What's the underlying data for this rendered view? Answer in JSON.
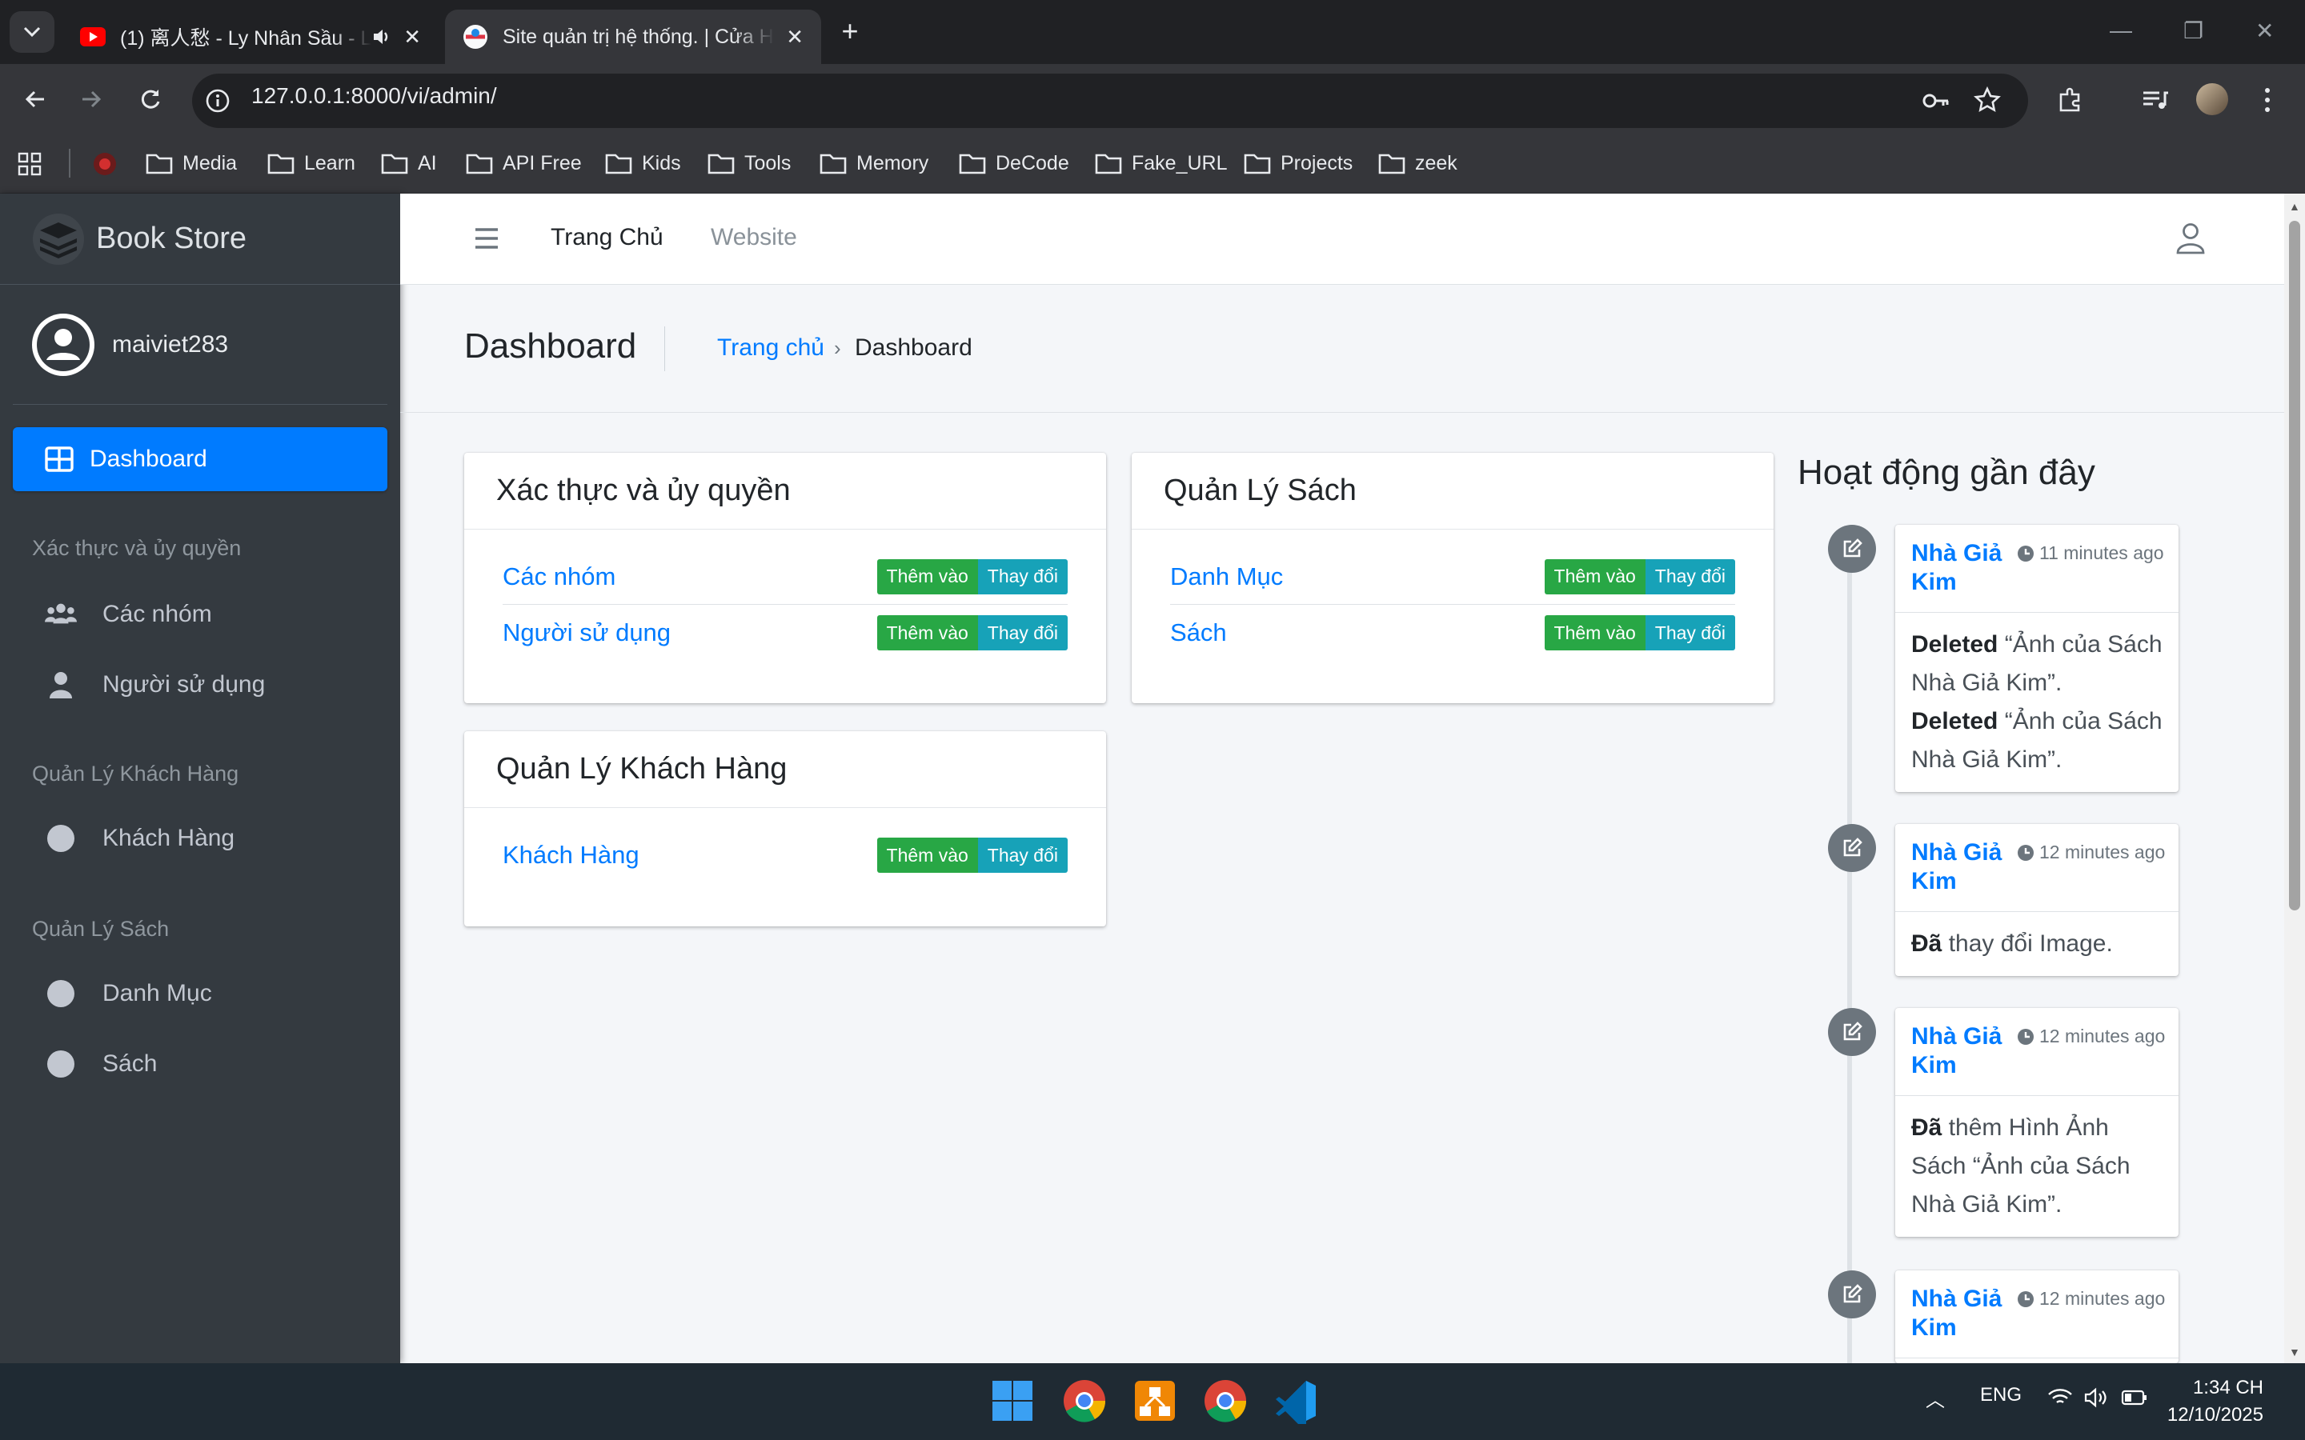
{
  "browser": {
    "tabs": [
      {
        "title": "(1) 离人愁 - Ly Nhân Sầu - L",
        "icon": "youtube-icon",
        "audio": true
      },
      {
        "title": "Site quản trị hệ thống. | Cửa Hà",
        "icon": "site-favicon",
        "active": true
      }
    ],
    "url": "127.0.0.1:8000/vi/admin/",
    "bookmarks": [
      "Media",
      "Learn",
      "AI",
      "API Free",
      "Kids",
      "Tools",
      "Memory",
      "DeCode",
      "Fake_URL",
      "Projects",
      "zeek"
    ]
  },
  "sidebar": {
    "brand": "Book Store",
    "user": "maiviet283",
    "active_item": "Dashboard",
    "sections": [
      {
        "header": "Xác thực và ủy quyền",
        "items": [
          {
            "label": "Các nhóm",
            "icon": "users-icon"
          },
          {
            "label": "Người sử dụng",
            "icon": "user-icon"
          }
        ]
      },
      {
        "header": "Quản Lý Khách Hàng",
        "items": [
          {
            "label": "Khách Hàng",
            "icon": "circle-icon"
          }
        ]
      },
      {
        "header": "Quản Lý Sách",
        "items": [
          {
            "label": "Danh Mục",
            "icon": "circle-icon"
          },
          {
            "label": "Sách",
            "icon": "circle-icon"
          }
        ]
      }
    ]
  },
  "topnav": {
    "home": "Trang Chủ",
    "website": "Website"
  },
  "header": {
    "title": "Dashboard",
    "breadcrumb": [
      "Trang chủ",
      "Dashboard"
    ],
    "sep": "›"
  },
  "buttons": {
    "add": "Thêm vào",
    "change": "Thay đổi"
  },
  "apps": [
    {
      "title": "Xác thực và ủy quyền",
      "models": [
        "Các nhóm",
        "Người sử dụng"
      ]
    },
    {
      "title": "Quản Lý Sách",
      "models": [
        "Danh Mục",
        "Sách"
      ]
    },
    {
      "title": "Quản Lý Khách Hàng",
      "models": [
        "Khách Hàng"
      ]
    }
  ],
  "recent": {
    "title": "Hoạt động gần đây",
    "entries": [
      {
        "author": "Nhà Giả Kim",
        "time": "11 minutes ago"
      },
      {
        "author": "Nhà Giả Kim",
        "time": "12 minutes ago",
        "action_bold": "Đã",
        "action_text": "thay đổi Image."
      },
      {
        "author": "Nhà Giả Kim",
        "time": "12 minutes ago",
        "action_bold": "Đã",
        "action_text": "thêm Hình Ảnh Sách “Ảnh của Sách Nhà Giả Kim”."
      },
      {
        "author": "Nhà Giả Kim",
        "time": "12 minutes ago"
      }
    ],
    "deleted_label": "Deleted",
    "deleted_items": [
      "“Ảnh của Sách Nhà Giả Kim”.",
      "“Ảnh của Sách Nhà Giả Kim”."
    ]
  },
  "taskbar": {
    "lang": "ENG",
    "time": "1:34 CH",
    "date": "12/10/2025"
  },
  "colors": {
    "primary": "#007bff",
    "success": "#28a745",
    "info": "#17a2b8",
    "sidebar": "#343a40"
  }
}
